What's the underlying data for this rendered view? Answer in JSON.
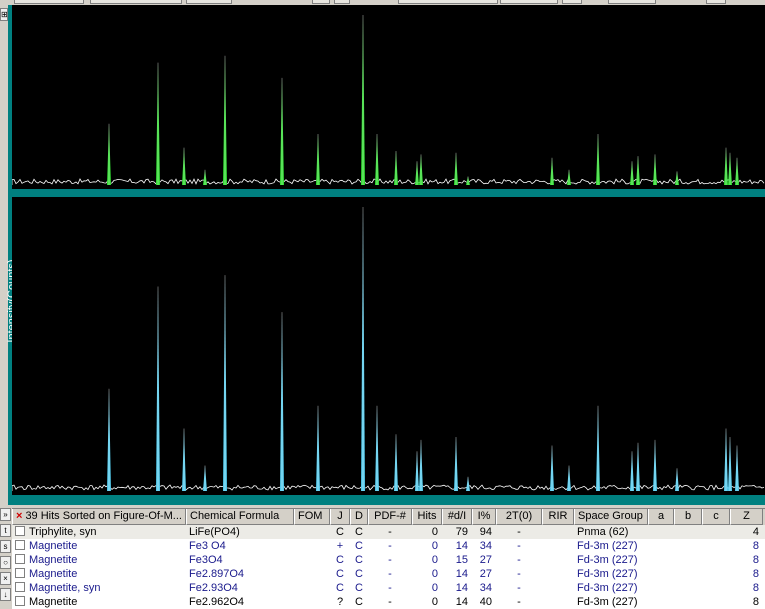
{
  "plot": {
    "y_axis_label": "Intensity(Counts)",
    "colors": {
      "background": "#000000",
      "frame": "#008080",
      "noise": "#ffffff",
      "pattern_top": "#33dd33",
      "pattern_bottom": "#55ccee"
    }
  },
  "hits_table": {
    "title": "39 Hits Sorted on Figure-Of-M...",
    "columns": {
      "formula": "Chemical Formula",
      "fom": "FOM",
      "j": "J",
      "d": "D",
      "pdf": "PDF-#",
      "hits": "Hits",
      "dI": "#d/I",
      "ipct": "I%",
      "twotheta": "2T(0)",
      "rir": "RIR",
      "space_group": "Space Group",
      "a": "a",
      "b": "b",
      "c": "c",
      "z": "Z"
    },
    "rows": [
      {
        "name": "Triphylite, syn",
        "formula": "LiFe(PO4)",
        "fom": "",
        "j": "C",
        "d": "C",
        "pdf": "-",
        "hits": "0",
        "dI": "79",
        "ipct": "94",
        "twotheta": "-",
        "rir": "",
        "space_group": "Pnma (62)",
        "a": "",
        "b": "",
        "c": "",
        "z": "4"
      },
      {
        "name": "Magnetite",
        "formula": "Fe3 O4",
        "fom": "",
        "j": "+",
        "d": "C",
        "pdf": "-",
        "hits": "0",
        "dI": "14",
        "ipct": "34",
        "twotheta": "-",
        "rir": "",
        "space_group": "Fd-3m (227)",
        "a": "",
        "b": "",
        "c": "",
        "z": "8"
      },
      {
        "name": "Magnetite",
        "formula": "Fe3O4",
        "fom": "",
        "j": "C",
        "d": "C",
        "pdf": "-",
        "hits": "0",
        "dI": "15",
        "ipct": "27",
        "twotheta": "-",
        "rir": "",
        "space_group": "Fd-3m (227)",
        "a": "",
        "b": "",
        "c": "",
        "z": "8"
      },
      {
        "name": "Magnetite",
        "formula": "Fe2.897O4",
        "fom": "",
        "j": "C",
        "d": "C",
        "pdf": "-",
        "hits": "0",
        "dI": "14",
        "ipct": "27",
        "twotheta": "-",
        "rir": "",
        "space_group": "Fd-3m (227)",
        "a": "",
        "b": "",
        "c": "",
        "z": "8"
      },
      {
        "name": "Magnetite, syn",
        "formula": "Fe2.93O4",
        "fom": "",
        "j": "C",
        "d": "C",
        "pdf": "-",
        "hits": "0",
        "dI": "14",
        "ipct": "34",
        "twotheta": "-",
        "rir": "",
        "space_group": "Fd-3m (227)",
        "a": "",
        "b": "",
        "c": "",
        "z": "8"
      },
      {
        "name": "Magnetite",
        "formula": "Fe2.962O4",
        "fom": "",
        "j": "?",
        "d": "C",
        "pdf": "-",
        "hits": "0",
        "dI": "14",
        "ipct": "40",
        "twotheta": "-",
        "rir": "",
        "space_group": "Fd-3m (227)",
        "a": "",
        "b": "",
        "c": "",
        "z": "8"
      }
    ]
  }
}
